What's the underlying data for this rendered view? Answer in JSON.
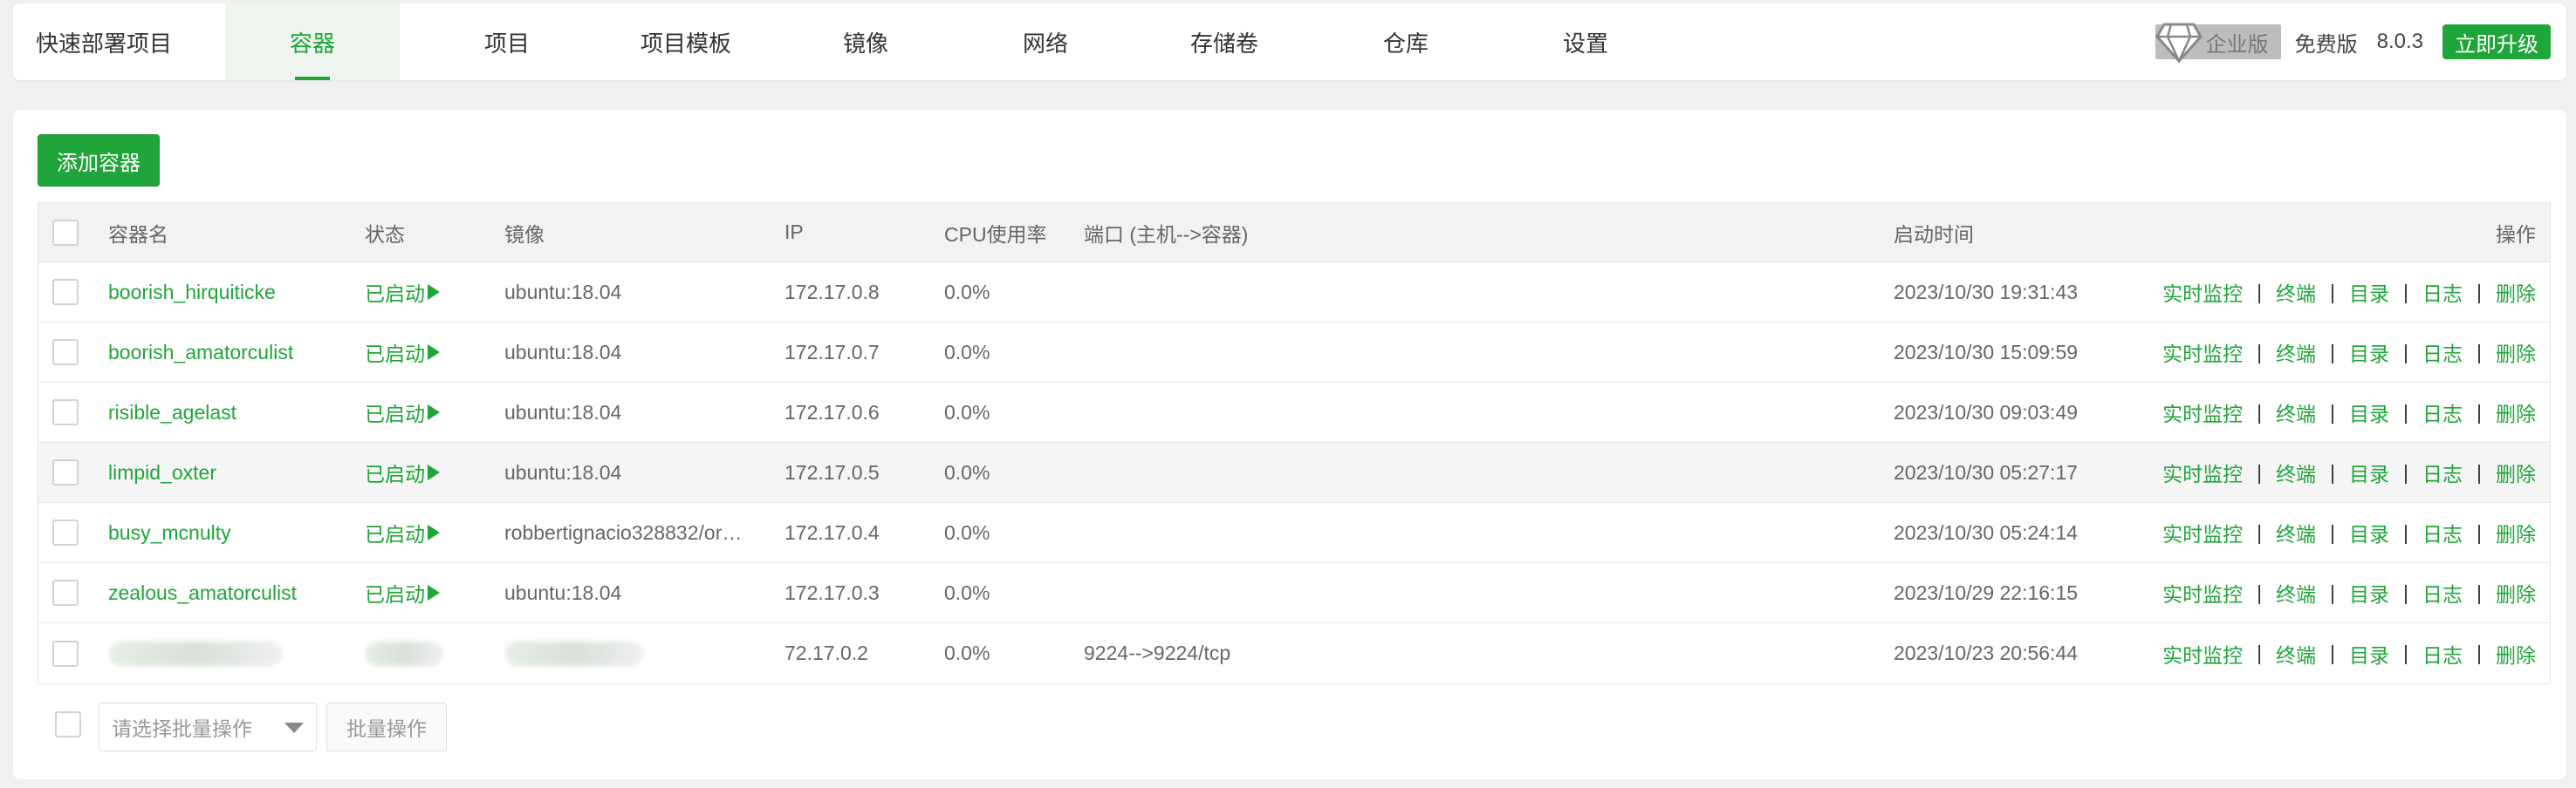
{
  "nav": {
    "tabs": [
      {
        "label": "快速部署项目"
      },
      {
        "label": "容器",
        "active": true
      },
      {
        "label": "项目"
      },
      {
        "label": "项目模板"
      },
      {
        "label": "镜像"
      },
      {
        "label": "网络"
      },
      {
        "label": "存储卷"
      },
      {
        "label": "仓库"
      },
      {
        "label": "设置"
      }
    ],
    "enterprise_label": "企业版",
    "free_label": "免费版",
    "version": "8.0.3",
    "upgrade_label": "立即升级"
  },
  "toolbar": {
    "add_label": "添加容器"
  },
  "table": {
    "headers": {
      "name": "容器名",
      "status": "状态",
      "image": "镜像",
      "ip": "IP",
      "cpu": "CPU使用率",
      "port": "端口 (主机-->容器)",
      "time": "启动时间",
      "ops": "操作"
    },
    "ops_labels": [
      "实时监控",
      "终端",
      "目录",
      "日志",
      "删除"
    ],
    "rows": [
      {
        "name": "boorish_hirquiticke",
        "status": "已启动",
        "image": "ubuntu:18.04",
        "ip": "172.17.0.8",
        "cpu": "0.0%",
        "port": "",
        "time": "2023/10/30 19:31:43"
      },
      {
        "name": "boorish_amatorculist",
        "status": "已启动",
        "image": "ubuntu:18.04",
        "ip": "172.17.0.7",
        "cpu": "0.0%",
        "port": "",
        "time": "2023/10/30 15:09:59"
      },
      {
        "name": "risible_agelast",
        "status": "已启动",
        "image": "ubuntu:18.04",
        "ip": "172.17.0.6",
        "cpu": "0.0%",
        "port": "",
        "time": "2023/10/30 09:03:49"
      },
      {
        "name": "limpid_oxter",
        "status": "已启动",
        "image": "ubuntu:18.04",
        "ip": "172.17.0.5",
        "cpu": "0.0%",
        "port": "",
        "time": "2023/10/30 05:27:17"
      },
      {
        "name": "busy_mcnulty",
        "status": "已启动",
        "image": "robbertignacio328832/or…",
        "ip": "172.17.0.4",
        "cpu": "0.0%",
        "port": "",
        "time": "2023/10/30 05:24:14"
      },
      {
        "name": "zealous_amatorculist",
        "status": "已启动",
        "image": "ubuntu:18.04",
        "ip": "172.17.0.3",
        "cpu": "0.0%",
        "port": "",
        "time": "2023/10/29 22:16:15"
      },
      {
        "name": "",
        "status": "",
        "image": "",
        "ip": "72.17.0.2",
        "cpu": "0.0%",
        "port": "9224-->9224/tcp",
        "time": "2023/10/23 20:56:44"
      }
    ]
  },
  "batch": {
    "select_placeholder": "请选择批量操作",
    "button_label": "批量操作"
  },
  "colors": {
    "accent": "#20a53a",
    "badge_bg": "#bdbdbd"
  }
}
